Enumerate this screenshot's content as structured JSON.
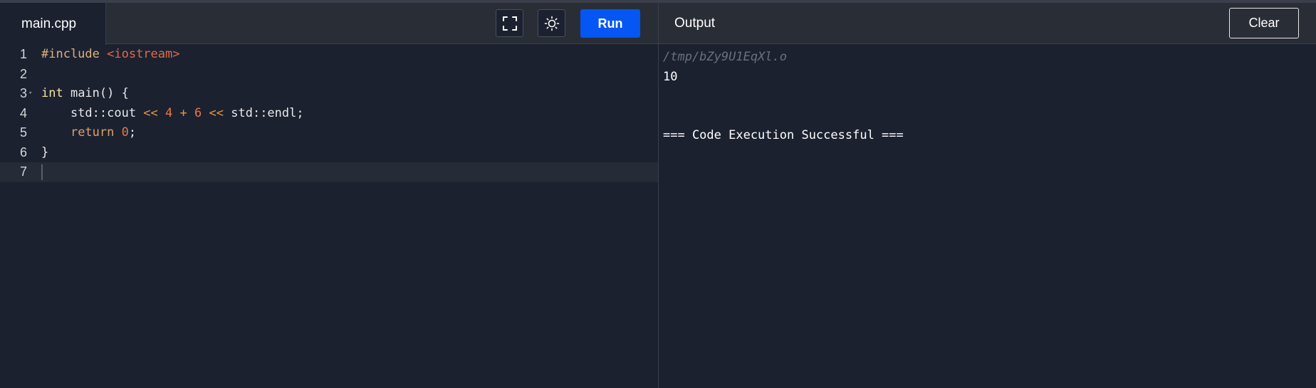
{
  "editor": {
    "tab_label": "main.cpp",
    "run_label": "Run",
    "line_numbers": [
      "1",
      "2",
      "3",
      "4",
      "5",
      "6",
      "7"
    ],
    "lines": [
      [
        {
          "t": "#include ",
          "c": "pp"
        },
        {
          "t": "<iostream>",
          "c": "str"
        }
      ],
      [],
      [
        {
          "t": "int",
          "c": "kw"
        },
        {
          "t": " main() {",
          "c": "id"
        }
      ],
      [
        {
          "t": "    std::cout ",
          "c": "id"
        },
        {
          "t": "<<",
          "c": "op"
        },
        {
          "t": " ",
          "c": "id"
        },
        {
          "t": "4",
          "c": "num"
        },
        {
          "t": " ",
          "c": "id"
        },
        {
          "t": "+",
          "c": "op"
        },
        {
          "t": " ",
          "c": "id"
        },
        {
          "t": "6",
          "c": "num"
        },
        {
          "t": " ",
          "c": "id"
        },
        {
          "t": "<<",
          "c": "op"
        },
        {
          "t": " std::endl;",
          "c": "id"
        }
      ],
      [
        {
          "t": "    ",
          "c": "id"
        },
        {
          "t": "return",
          "c": "ret"
        },
        {
          "t": " ",
          "c": "id"
        },
        {
          "t": "0",
          "c": "num"
        },
        {
          "t": ";",
          "c": "id"
        }
      ],
      [
        {
          "t": "}",
          "c": "id"
        }
      ],
      []
    ],
    "active_line": 7,
    "fold_line": 3,
    "fold_glyph": "▾"
  },
  "output": {
    "title": "Output",
    "clear_label": "Clear",
    "path": "/tmp/bZy9U1EqXl.o",
    "lines": [
      "10",
      "",
      "",
      "=== Code Execution Successful ==="
    ]
  },
  "icons": {
    "fullscreen": "fullscreen-icon",
    "theme": "sun-icon"
  },
  "colors": {
    "run_button": "#0556f3",
    "background": "#1c2130",
    "toolbar": "#292d36"
  }
}
